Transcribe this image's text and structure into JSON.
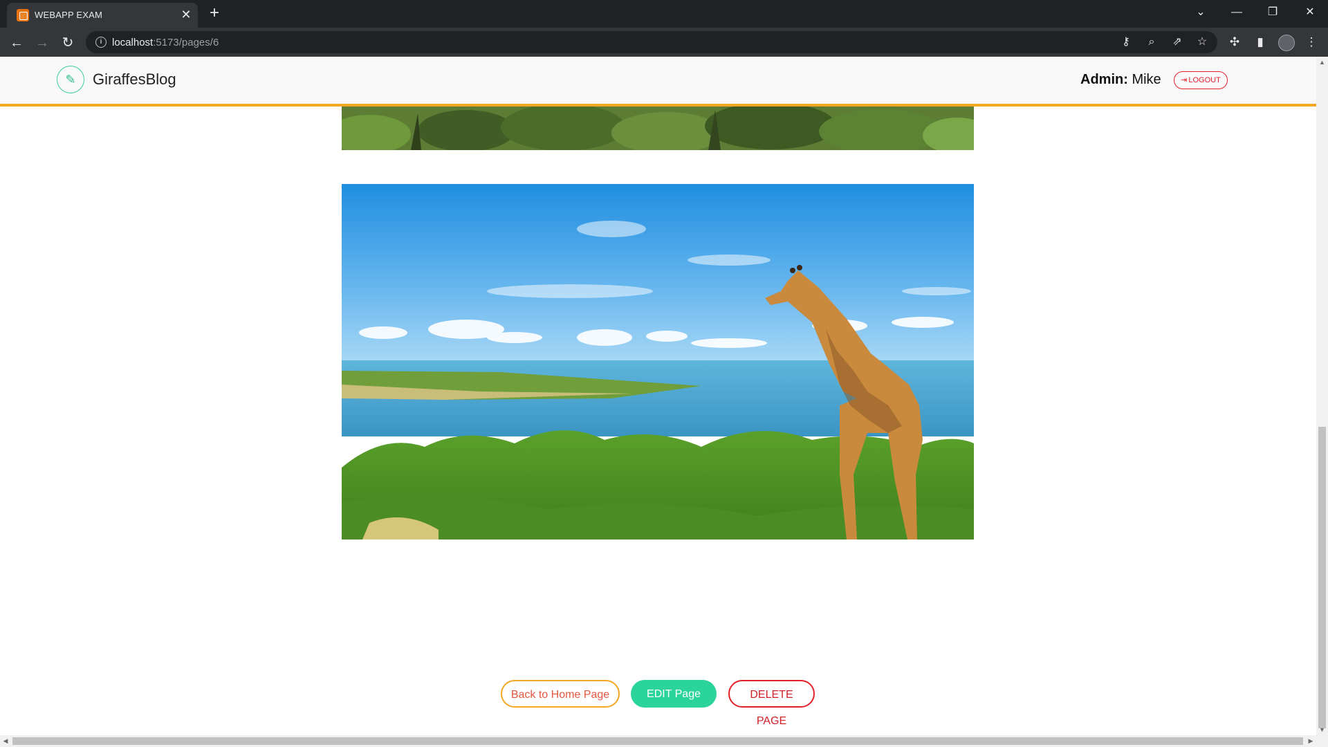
{
  "browser": {
    "tab_title": "WEBAPP EXAM",
    "tab_close": "✕",
    "new_tab": "+",
    "url_host": "localhost",
    "url_rest": ":5173/pages/6",
    "window_controls": {
      "dropdown": "⌄",
      "minimize": "—",
      "restore": "❐",
      "close": "✕"
    }
  },
  "header": {
    "brand": "GiraffesBlog",
    "admin_label": "Admin:",
    "admin_name": "Mike",
    "logout_label": "LOGOUT"
  },
  "actions": {
    "back_label": "Back to Home Page",
    "edit_label": "EDIT Page",
    "delete_label": "DELETE PAGE"
  },
  "colors": {
    "accent_orange": "#f5a623",
    "accent_green": "#2bd49b",
    "danger_red": "#e2202a"
  }
}
